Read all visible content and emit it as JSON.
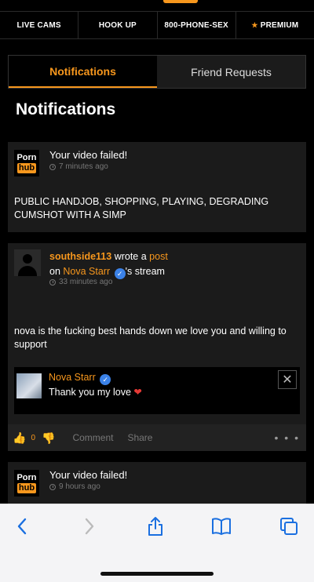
{
  "nav": {
    "items": [
      {
        "label": "LIVE CAMS"
      },
      {
        "label": "HOOK UP"
      },
      {
        "label": "800-PHONE-SEX"
      },
      {
        "label": "PREMIUM"
      }
    ],
    "accent": "#f7971d"
  },
  "tabs": [
    {
      "label": "Notifications",
      "active": true
    },
    {
      "label": "Friend Requests",
      "active": false
    }
  ],
  "page_title": "Notifications",
  "logo": {
    "line1": "Porn",
    "line2": "hub"
  },
  "notifications": [
    {
      "title": "Your video failed!",
      "time": "7 minutes ago",
      "body": "PUBLIC HANDJOB, SHOPPING, PLAYING, DEGRADING CUMSHOT WITH A SIMP"
    },
    {
      "user": "southside113",
      "wrote_a": "wrote a",
      "post_link": "post",
      "on": "on",
      "target": "Nova Starr",
      "stream_suffix": "'s stream",
      "time": "33 minutes ago",
      "body": "nova is the fucking best hands down we love you and willing to support",
      "reply": {
        "name": "Nova Starr",
        "text": "Thank you my love"
      },
      "actions": {
        "like_count": "0",
        "comment": "Comment",
        "share": "Share"
      }
    },
    {
      "title": "Your video failed!",
      "time": "9 hours ago"
    }
  ],
  "icons": {
    "back": "chevron-left-icon",
    "forward": "chevron-right-icon",
    "share": "share-icon",
    "bookmarks": "book-icon",
    "tabs": "tabs-icon"
  }
}
